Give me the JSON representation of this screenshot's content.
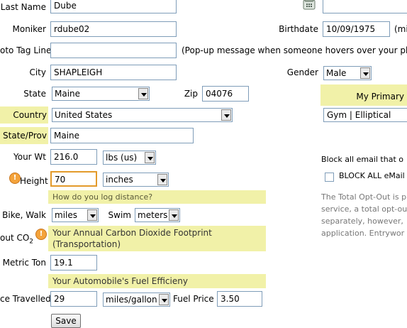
{
  "form": {
    "last_name": {
      "label": "Last Name",
      "value": "Dube"
    },
    "moniker": {
      "label": "Moniker",
      "value": "rdube02"
    },
    "photo_tag": {
      "label": "oto Tag Line",
      "value": "",
      "hint": "(Pop-up message when someone hovers over your phot"
    },
    "city": {
      "label": "City",
      "value": "SHAPLEIGH"
    },
    "state": {
      "label": "State",
      "value": "Maine"
    },
    "zip": {
      "label": "Zip",
      "value": "04076"
    },
    "country": {
      "label": "Country",
      "value": "United States"
    },
    "state_prov": {
      "label": "State/Prov",
      "value": "Maine"
    },
    "weight": {
      "label": "Your Wt",
      "value": "216.0",
      "unit": "lbs (us)"
    },
    "height": {
      "label": "Height",
      "value": "70",
      "unit": "inches"
    },
    "log_distance": {
      "heading": "How do you log distance?"
    },
    "bike_walk": {
      "label": "Bike, Walk",
      "value": "miles"
    },
    "swim": {
      "label": "Swim",
      "value": "meters"
    },
    "co2": {
      "label_main": "out CO",
      "label_sub": "2",
      "heading_line1": "Your Annual Carbon Dioxide Footprint",
      "heading_line2": "(Transportation)"
    },
    "metric_ton": {
      "label": "Metric Ton",
      "value": "19.1"
    },
    "fuel_eff": {
      "heading": "Your Automobile's Fuel Efficieny"
    },
    "distance": {
      "label": "ce Travelled",
      "value": "29",
      "unit": "miles/gallon"
    },
    "fuel_price": {
      "label": "Fuel Price",
      "value": "3.50"
    },
    "save_label": "Save"
  },
  "right": {
    "phone_value": "",
    "birthdate": {
      "label": "Birthdate",
      "value": "10/09/1975",
      "hint": "(mi"
    },
    "gender": {
      "label": "Gender",
      "value": "Male"
    },
    "primary_heading": "My Primary",
    "primary_value": "Gym | Elliptical",
    "block_email_text": "Block all email that o",
    "block_all_label": "BLOCK ALL eMail",
    "optout_lines": [
      "The Total Opt-Out is p",
      "service, a total opt-ou",
      "separately, however,",
      "application.  Entrywor"
    ]
  },
  "colors": {
    "highlight": "#f1f1a8",
    "input_border": "#7f9db9",
    "info_icon": "#f4a33b"
  }
}
